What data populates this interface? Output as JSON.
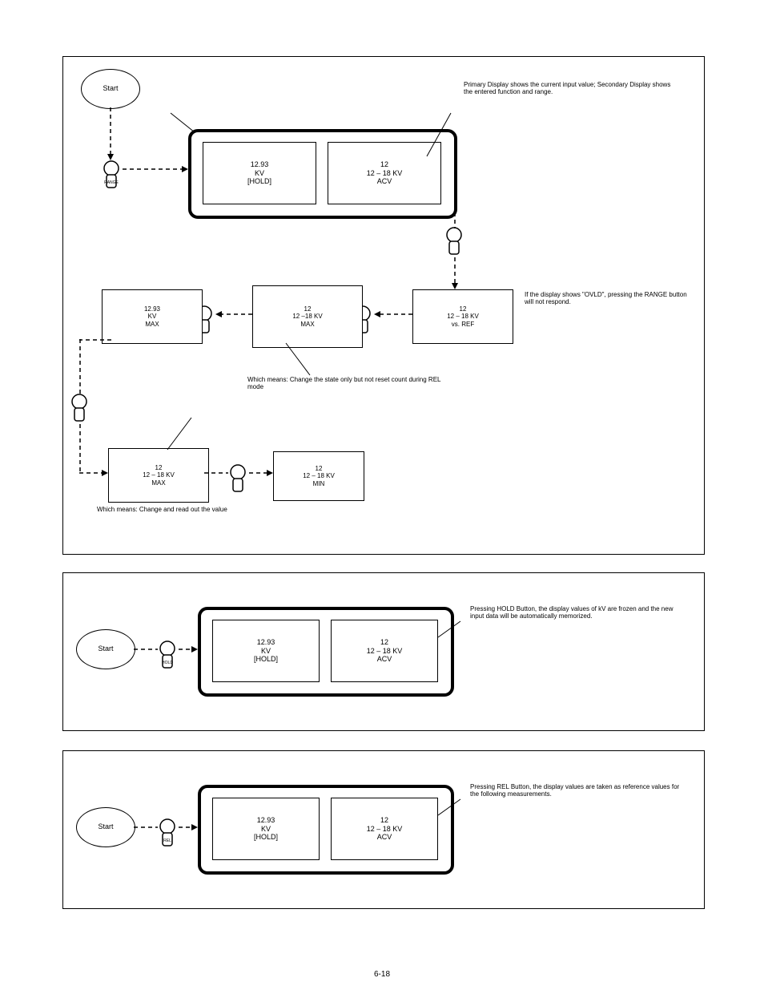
{
  "footer": "6-18",
  "panel1": {
    "start": "Start",
    "p1a": {
      "l1": "12.93",
      "l2": "KV",
      "l3": "[HOLD]"
    },
    "p1b": {
      "l1": "12",
      "l2": "12 – 18 KV",
      "l3": "ACV"
    },
    "twin_annot": "Primary Display shows the current input value; Secondary Display shows the entered function and range.",
    "range_note": "If the display shows \"OVLD\", pressing the RANGE button will not respond.",
    "b2": {
      "l1": "12",
      "l2": "12 – 18 KV",
      "l3": "vs. REF"
    },
    "b3": {
      "l1": "12",
      "l2": "12 –18 KV",
      "l3": "MAX"
    },
    "b3_annot": "Which means: Change the state only but not reset count during REL mode",
    "b4": {
      "l1": "12.93",
      "l2": "KV",
      "l3": "MAX"
    },
    "b5": {
      "l1": "12",
      "l2": "12 – 18 KV",
      "l3": "MAX"
    },
    "b5_annot": "Which means: Change and read out the value",
    "b6": {
      "l1": "12",
      "l2": "12 – 18 KV",
      "l3": "MIN"
    },
    "icon_label": "RANGE"
  },
  "panel2": {
    "start": "Start",
    "pa": {
      "l1": "12.93",
      "l2": "KV",
      "l3": "[HOLD]"
    },
    "pb": {
      "l1": "12",
      "l2": "12 – 18 KV",
      "l3": "ACV"
    },
    "annot": "Pressing HOLD Button, the display values of kV are frozen and the new input data will be automatically memorized.",
    "icon_label": "HOLD"
  },
  "panel3": {
    "start": "Start",
    "pa": {
      "l1": "12.93",
      "l2": "KV",
      "l3": "[HOLD]"
    },
    "pb": {
      "l1": "12",
      "l2": "12 – 18 KV",
      "l3": "ACV"
    },
    "annot": "Pressing REL Button, the display values are taken as reference values for the following measurements.",
    "icon_label": "REL"
  }
}
